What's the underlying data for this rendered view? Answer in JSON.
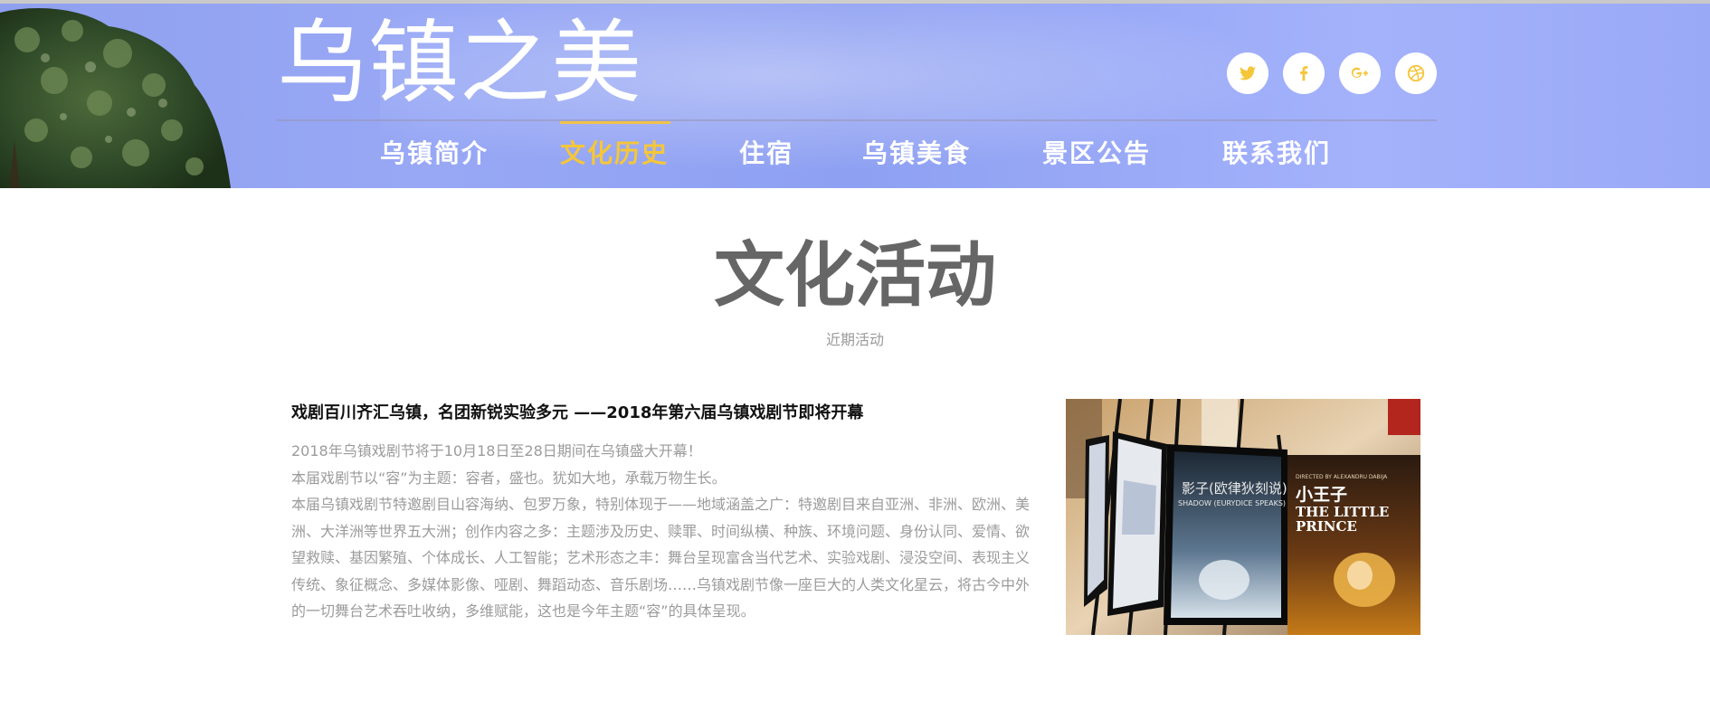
{
  "header": {
    "brand": "乌镇之美",
    "social": [
      {
        "icon": "twitter-icon",
        "color": "#f5c63a"
      },
      {
        "icon": "facebook-icon",
        "color": "#f5c63a"
      },
      {
        "icon": "google-plus-icon",
        "color": "#f5c63a"
      },
      {
        "icon": "dribbble-icon",
        "color": "#f5c63a"
      }
    ],
    "nav": [
      {
        "label": "乌镇简介",
        "active": false
      },
      {
        "label": "文化历史",
        "active": true
      },
      {
        "label": "住宿",
        "active": false
      },
      {
        "label": "乌镇美食",
        "active": false
      },
      {
        "label": "景区公告",
        "active": false
      },
      {
        "label": "联系我们",
        "active": false
      }
    ],
    "active_color": "#f5c63a"
  },
  "main": {
    "title": "文化活动",
    "subtitle": "近期活动",
    "article": {
      "title": "戏剧百川齐汇乌镇，名团新锐实验多元 ——2018年第六届乌镇戏剧节即将开幕",
      "paragraphs": [
        "2018年乌镇戏剧节将于10月18日至28日期间在乌镇盛大开幕！",
        "本届戏剧节以“容”为主题：容者，盛也。犹如大地，承载万物生长。",
        "本届乌镇戏剧节特邀剧目山容海纳、包罗万象，特别体现于——地域涵盖之广：特邀剧目来自亚洲、非洲、欧洲、美洲、大洋洲等世界五大洲；创作内容之多：主题涉及历史、赎罪、时间纵横、种族、环境问题、身份认同、爱情、欲望救赎、基因繁殖、个体成长、人工智能；艺术形态之丰：舞台呈现富含当代艺术、实验戏剧、浸没空间、表现主义传统、象征概念、多媒体影像、哑剧、舞蹈动态、音乐剧场……乌镇戏剧节像一座巨大的人类文化星云，将古今中外的一切舞台艺术吞吐收纳，多维赋能，这也是今年主题“容”的具体呈现。"
      ],
      "poster_texts": {
        "right_title_cn": "小王子",
        "right_title_en_1": "THE LITTLE",
        "right_title_en_2": "PRINCE",
        "right_director": "DIRECTED BY ALEXANDRU DABIJA",
        "middle_title": "影子(欧律狄刻说)",
        "middle_subtitle": "SHADOW (EURYDICE SPEAKS)"
      }
    }
  }
}
